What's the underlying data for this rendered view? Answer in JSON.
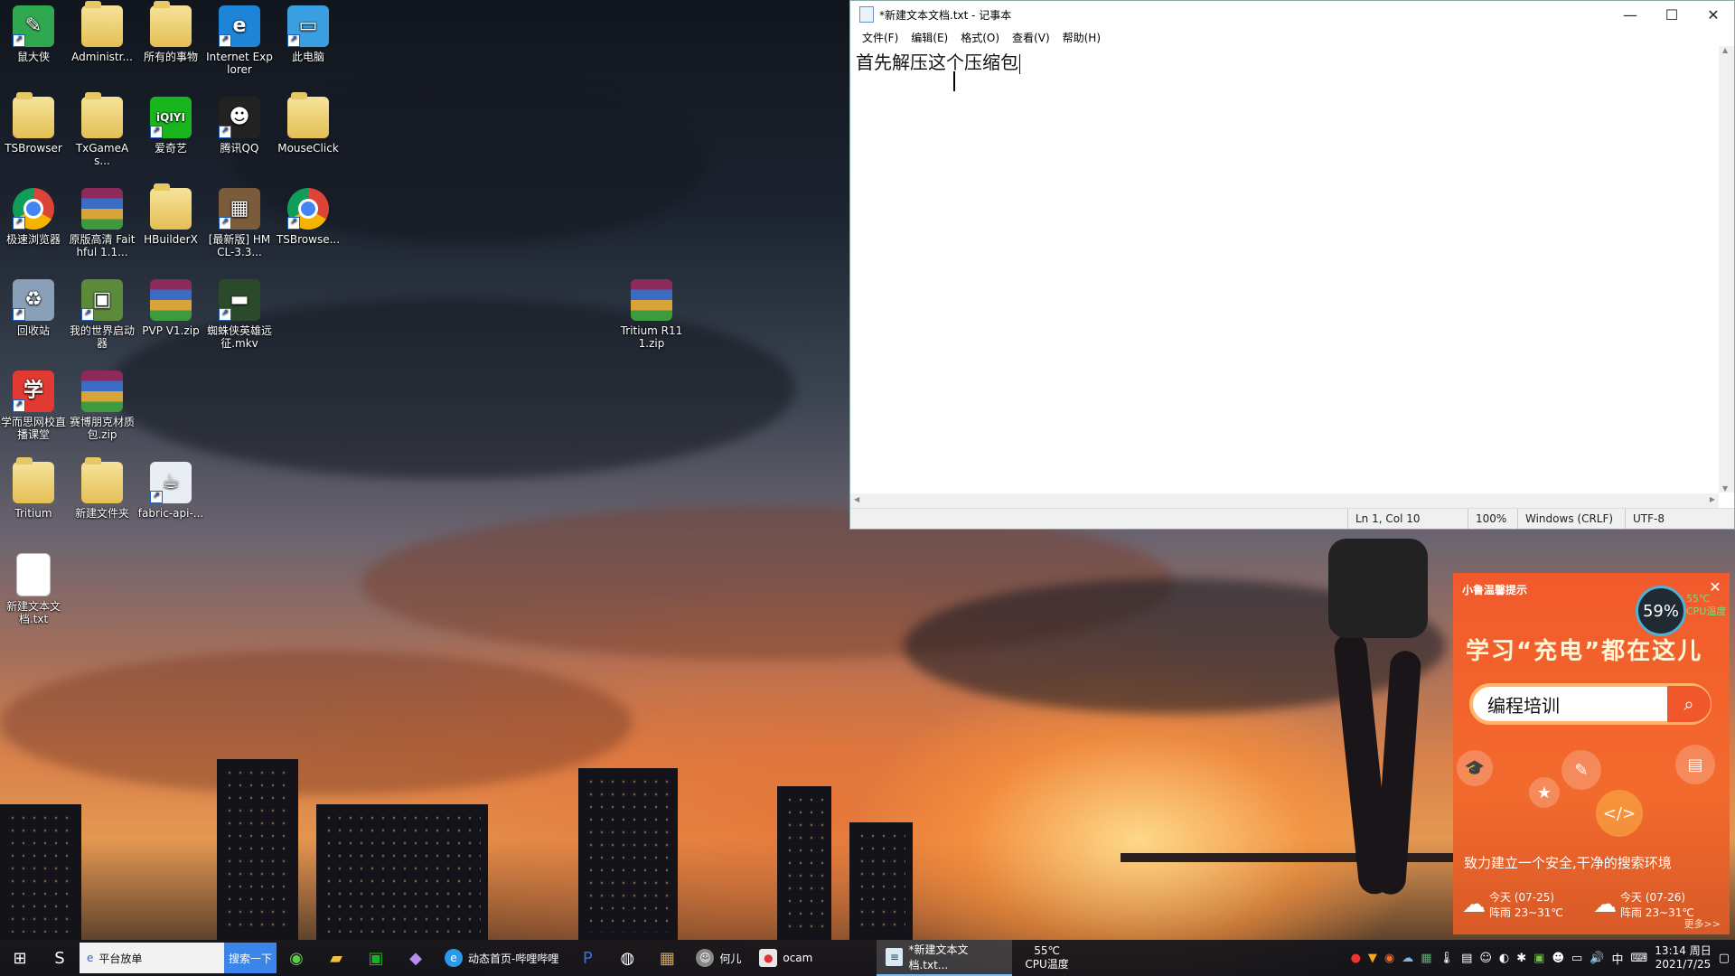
{
  "desktop": {
    "icons": [
      {
        "label": "鼠大侠",
        "glyph": "✎",
        "color": "#2fa84f",
        "kind": "app"
      },
      {
        "label": "Administr...",
        "glyph": "",
        "kind": "folder"
      },
      {
        "label": "所有的事物",
        "glyph": "",
        "kind": "folder"
      },
      {
        "label": "Internet Explorer",
        "glyph": "e",
        "color": "#1d84d8",
        "kind": "app"
      },
      {
        "label": "此电脑",
        "glyph": "▭",
        "color": "#3a9fe0",
        "kind": "app"
      },
      {
        "label": "TSBrowser",
        "glyph": "",
        "kind": "folder"
      },
      {
        "label": "TxGameAs...",
        "glyph": "",
        "kind": "folder"
      },
      {
        "label": "爱奇艺",
        "glyph": "iQIYI",
        "color": "#19b51f",
        "kind": "app"
      },
      {
        "label": "腾讯QQ",
        "glyph": "☻",
        "color": "#222",
        "kind": "app"
      },
      {
        "label": "MouseClick",
        "glyph": "",
        "kind": "folder"
      },
      {
        "label": "极速浏览器",
        "glyph": "",
        "kind": "chrome"
      },
      {
        "label": "原版高清 Faithful 1.1...",
        "glyph": "",
        "kind": "winrar"
      },
      {
        "label": "HBuilderX",
        "glyph": "",
        "kind": "folder"
      },
      {
        "label": "[最新版] HMCL-3.3...",
        "glyph": "▦",
        "color": "#7a5b3a",
        "kind": "app"
      },
      {
        "label": "TSBrowse...",
        "glyph": "",
        "kind": "chrome"
      },
      {
        "label": "回收站",
        "glyph": "♻",
        "color": "#8aa0b8",
        "kind": "app"
      },
      {
        "label": "我的世界启动器",
        "glyph": "▣",
        "color": "#5a8a3a",
        "kind": "app"
      },
      {
        "label": "PVP V1.zip",
        "glyph": "",
        "kind": "winrar"
      },
      {
        "label": "蜘蛛侠英雄远征.mkv",
        "glyph": "▬",
        "color": "#2b4a2b",
        "kind": "app"
      },
      {
        "label": "学而思网校直播课堂",
        "glyph": "学",
        "color": "#e23a32",
        "kind": "app"
      },
      {
        "label": "赛博朋克材质包.zip",
        "glyph": "",
        "kind": "winrar"
      },
      {
        "label": "Tritium",
        "glyph": "",
        "kind": "folder"
      },
      {
        "label": "新建文件夹",
        "glyph": "",
        "kind": "folder"
      },
      {
        "label": "fabric-api-...",
        "glyph": "☕",
        "color": "#e9eef5",
        "kind": "app"
      },
      {
        "label": "新建文本文档.txt",
        "glyph": "",
        "kind": "doc"
      },
      {
        "label": "Tritium R111.zip",
        "glyph": "",
        "kind": "winrar"
      }
    ]
  },
  "notepad": {
    "title": "*新建文本文档.txt - 记事本",
    "menu": [
      "文件(F)",
      "编辑(E)",
      "格式(O)",
      "查看(V)",
      "帮助(H)"
    ],
    "content": "首先解压这个压缩包",
    "status": {
      "position": "Ln 1, Col 10",
      "zoom": "100%",
      "line_ending": "Windows (CRLF)",
      "encoding": "UTF-8"
    }
  },
  "popup": {
    "header": "小鲁温馨提示",
    "headline": "学习“充电”都在这儿",
    "search_text": "编程培训",
    "slogan": "致力建立一个安全,干净的搜索环境",
    "weather": [
      {
        "day": "今天 (07-25)",
        "desc": "阵雨 23~31℃"
      },
      {
        "day": "今天 (07-26)",
        "desc": "阵雨 23~31℃"
      }
    ],
    "more": "更多>>",
    "cpu_percent": "59%",
    "cpu_temp": "55℃",
    "cpu_temp_label": "CPU温度"
  },
  "taskbar": {
    "search_placeholder": "平台放单",
    "search_button": "搜索一下",
    "apps": [
      {
        "label": "动态首页-哔哩哔哩",
        "active": false
      },
      {
        "label": "何儿",
        "active": false
      },
      {
        "label": "ocam",
        "active": false
      },
      {
        "label": "*新建文本文档.txt...",
        "active": true
      }
    ],
    "cpu_temp": "55℃",
    "cpu_temp_label": "CPU温度",
    "ime": "中",
    "time": "13:14 周日",
    "date": "2021/7/25"
  }
}
